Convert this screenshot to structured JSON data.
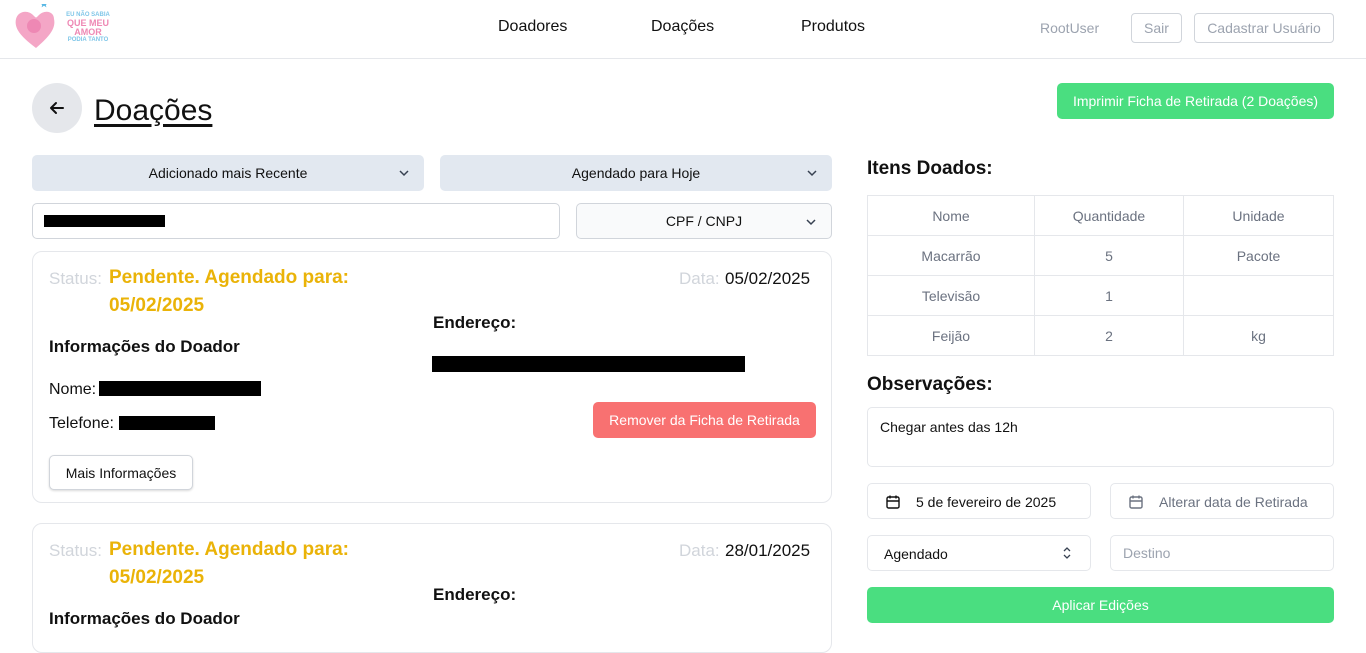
{
  "header": {
    "logo": {
      "line1": "EU NÃO SABIA",
      "line2": "QUE MEU",
      "line3": "AMOR",
      "line4": "PODIA TANTO"
    },
    "nav": [
      "Doadores",
      "Doações",
      "Produtos"
    ],
    "user": "RootUser",
    "logout_label": "Sair",
    "register_label": "Cadastrar Usuário"
  },
  "page": {
    "title": "Doações",
    "print_label": "Imprimir Ficha de Retirada (2 Doações)"
  },
  "filters": {
    "sort": "Adicionado mais Recente",
    "schedule": "Agendado para Hoje",
    "doc_type": "CPF / CNPJ"
  },
  "cards": [
    {
      "status_label": "Status:",
      "status": "Pendente. Agendado para: 05/02/2025",
      "date_label": "Data:",
      "date": "05/02/2025",
      "donor_heading": "Informações do Doador",
      "address_heading": "Endereço:",
      "name_label": "Nome:",
      "phone_label": "Telefone:",
      "remove_label": "Remover da Ficha de Retirada",
      "more_label": "Mais Informações"
    },
    {
      "status_label": "Status:",
      "status": "Pendente. Agendado para: 05/02/2025",
      "date_label": "Data:",
      "date": "28/01/2025",
      "donor_heading": "Informações do Doador",
      "address_heading": "Endereço:"
    }
  ],
  "items": {
    "heading": "Itens Doados:",
    "columns": [
      "Nome",
      "Quantidade",
      "Unidade"
    ],
    "rows": [
      [
        "Macarrão",
        "5",
        "Pacote"
      ],
      [
        "Televisão",
        "1",
        ""
      ],
      [
        "Feijão",
        "2",
        "kg"
      ]
    ]
  },
  "observations": {
    "heading": "Observações:",
    "text": "Chegar antes das 12h"
  },
  "edit": {
    "date": "5 de fevereiro de 2025",
    "change_date_label": "Alterar data de Retirada",
    "status": "Agendado",
    "destination_placeholder": "Destino",
    "apply_label": "Aplicar Edições"
  },
  "colors": {
    "green": "#4ade80",
    "red": "#f87171",
    "yellow": "#eab308",
    "gray_select": "#e2e8f0"
  }
}
